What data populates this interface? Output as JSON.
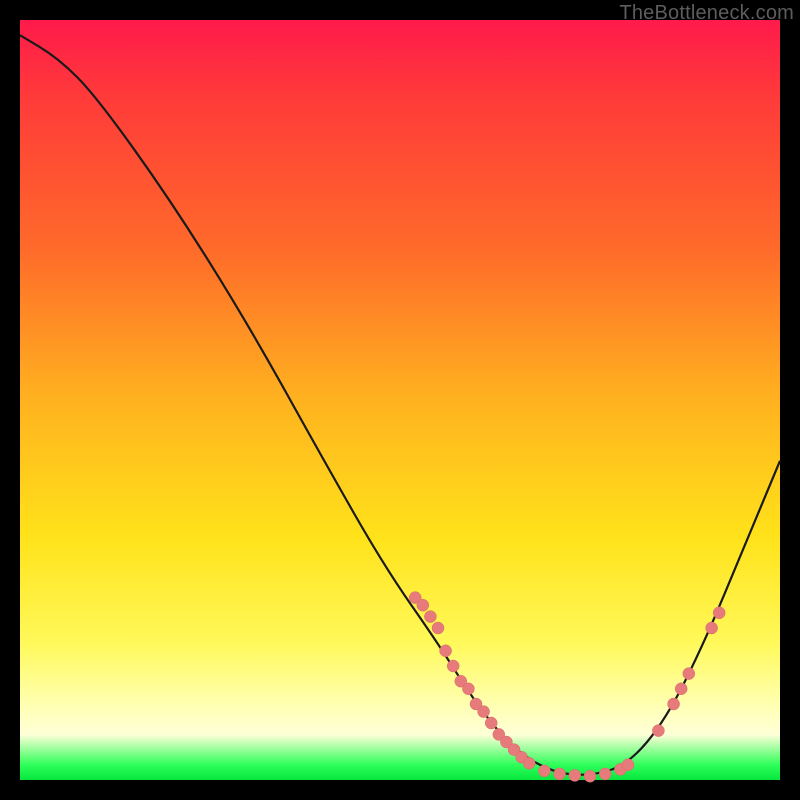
{
  "watermark": "TheBottleneck.com",
  "colors": {
    "curve_stroke": "#1a1a1a",
    "marker_fill": "#e77a7a",
    "marker_stroke": "#d96a6a"
  },
  "chart_data": {
    "type": "line",
    "title": "",
    "xlabel": "",
    "ylabel": "",
    "xlim": [
      0,
      100
    ],
    "ylim": [
      0,
      100
    ],
    "curve": [
      {
        "x": 0,
        "y": 98
      },
      {
        "x": 5,
        "y": 95
      },
      {
        "x": 10,
        "y": 90
      },
      {
        "x": 20,
        "y": 76
      },
      {
        "x": 30,
        "y": 60
      },
      {
        "x": 40,
        "y": 42
      },
      {
        "x": 48,
        "y": 28
      },
      {
        "x": 55,
        "y": 18
      },
      {
        "x": 60,
        "y": 10
      },
      {
        "x": 65,
        "y": 4
      },
      {
        "x": 70,
        "y": 1
      },
      {
        "x": 75,
        "y": 0.5
      },
      {
        "x": 80,
        "y": 2
      },
      {
        "x": 85,
        "y": 8
      },
      {
        "x": 90,
        "y": 18
      },
      {
        "x": 95,
        "y": 30
      },
      {
        "x": 100,
        "y": 42
      }
    ],
    "markers": [
      {
        "x": 52,
        "y": 24
      },
      {
        "x": 53,
        "y": 23
      },
      {
        "x": 54,
        "y": 21.5
      },
      {
        "x": 55,
        "y": 20
      },
      {
        "x": 56,
        "y": 17
      },
      {
        "x": 57,
        "y": 15
      },
      {
        "x": 58,
        "y": 13
      },
      {
        "x": 59,
        "y": 12
      },
      {
        "x": 60,
        "y": 10
      },
      {
        "x": 61,
        "y": 9
      },
      {
        "x": 62,
        "y": 7.5
      },
      {
        "x": 63,
        "y": 6
      },
      {
        "x": 64,
        "y": 5
      },
      {
        "x": 65,
        "y": 4
      },
      {
        "x": 66,
        "y": 3
      },
      {
        "x": 67,
        "y": 2.2
      },
      {
        "x": 69,
        "y": 1.2
      },
      {
        "x": 71,
        "y": 0.8
      },
      {
        "x": 73,
        "y": 0.6
      },
      {
        "x": 75,
        "y": 0.5
      },
      {
        "x": 77,
        "y": 0.8
      },
      {
        "x": 79,
        "y": 1.4
      },
      {
        "x": 80,
        "y": 2
      },
      {
        "x": 84,
        "y": 6.5
      },
      {
        "x": 86,
        "y": 10
      },
      {
        "x": 87,
        "y": 12
      },
      {
        "x": 88,
        "y": 14
      },
      {
        "x": 91,
        "y": 20
      },
      {
        "x": 92,
        "y": 22
      }
    ]
  }
}
